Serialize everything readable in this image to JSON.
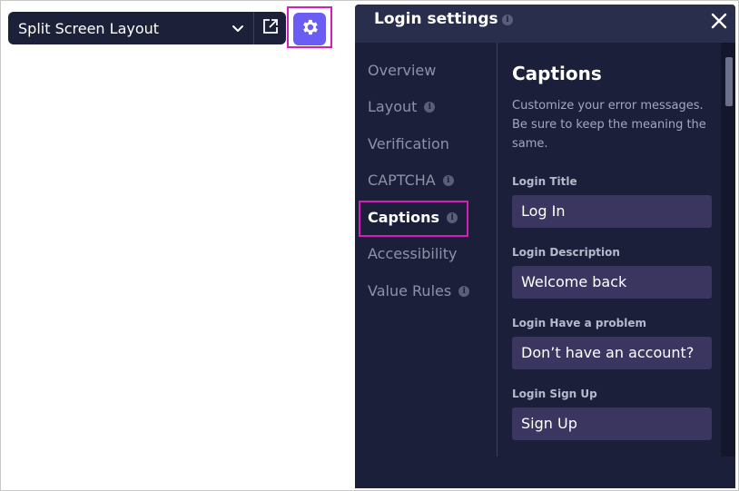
{
  "toolbar": {
    "layout_select_value": "Split Screen Layout"
  },
  "panel": {
    "title": "Login settings",
    "info_badge": "i"
  },
  "nav": {
    "items": [
      {
        "label": "Overview",
        "info": ""
      },
      {
        "label": "Layout",
        "info": "i"
      },
      {
        "label": "Verification",
        "info": ""
      },
      {
        "label": "CAPTCHA",
        "info": "i"
      },
      {
        "label": "Captions",
        "info": "i"
      },
      {
        "label": "Accessibility",
        "info": ""
      },
      {
        "label": "Value Rules",
        "info": "i"
      }
    ],
    "active": "Captions"
  },
  "content": {
    "title": "Captions",
    "description": "Customize your error messages. Be sure to keep the meaning the same.",
    "fields": [
      {
        "label": "Login Title",
        "value": "Log In"
      },
      {
        "label": "Login Description",
        "value": "Welcome back"
      },
      {
        "label": "Login Have a problem",
        "value": "Don’t have an account?"
      },
      {
        "label": "Login Sign Up",
        "value": "Sign Up"
      }
    ]
  },
  "colors": {
    "panel_bg": "#1b1f39",
    "accent": "#6b5cf4",
    "highlight": "#d21fb5"
  },
  "icons": [
    "chevron-down-icon",
    "external-link-icon",
    "gear-icon",
    "close-icon",
    "info-icon"
  ]
}
